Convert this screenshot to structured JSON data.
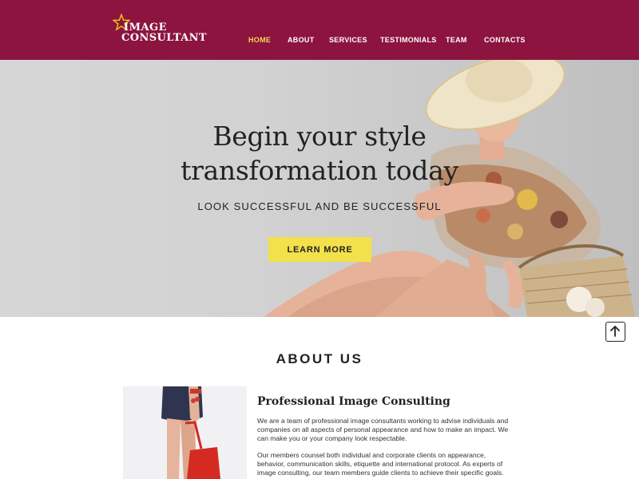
{
  "brand": {
    "line1": "IMAGE",
    "line2": "CONSULTANT",
    "star_color": "#f0c419"
  },
  "nav": {
    "items": [
      {
        "label": "HOME",
        "active": true
      },
      {
        "label": "ABOUT",
        "active": false
      },
      {
        "label": "SERVICES",
        "active": false
      },
      {
        "label": "TESTIMONIALS",
        "active": false
      },
      {
        "label": "TEAM",
        "active": false
      },
      {
        "label": "CONTACTS",
        "active": false
      }
    ]
  },
  "hero": {
    "title_line1": "Begin your style",
    "title_line2": "transformation today",
    "subtitle": "LOOK SUCCESSFUL AND BE SUCCESSFUL",
    "button_label": "LEARN MORE"
  },
  "about": {
    "section_title": "ABOUT US",
    "heading": "Professional Image Consulting",
    "paragraph1": "We are a team of professional image consultants working to advise individuals and companies on all aspects of personal appearance and how to make an impact. We can make you or your company look respectable.",
    "paragraph2": "Our members counsel both individual and corporate clients on appearance, behavior, communication skills, etiquette and international protocol. As experts of image consulting, our team members guide clients to achieve their specific goals."
  },
  "colors": {
    "header_bg": "#8c143e",
    "nav_active": "#f0d85a",
    "button_bg": "#f2e14a"
  },
  "icons": {
    "scroll_top": "arrow-up-icon",
    "logo": "star-icon"
  }
}
